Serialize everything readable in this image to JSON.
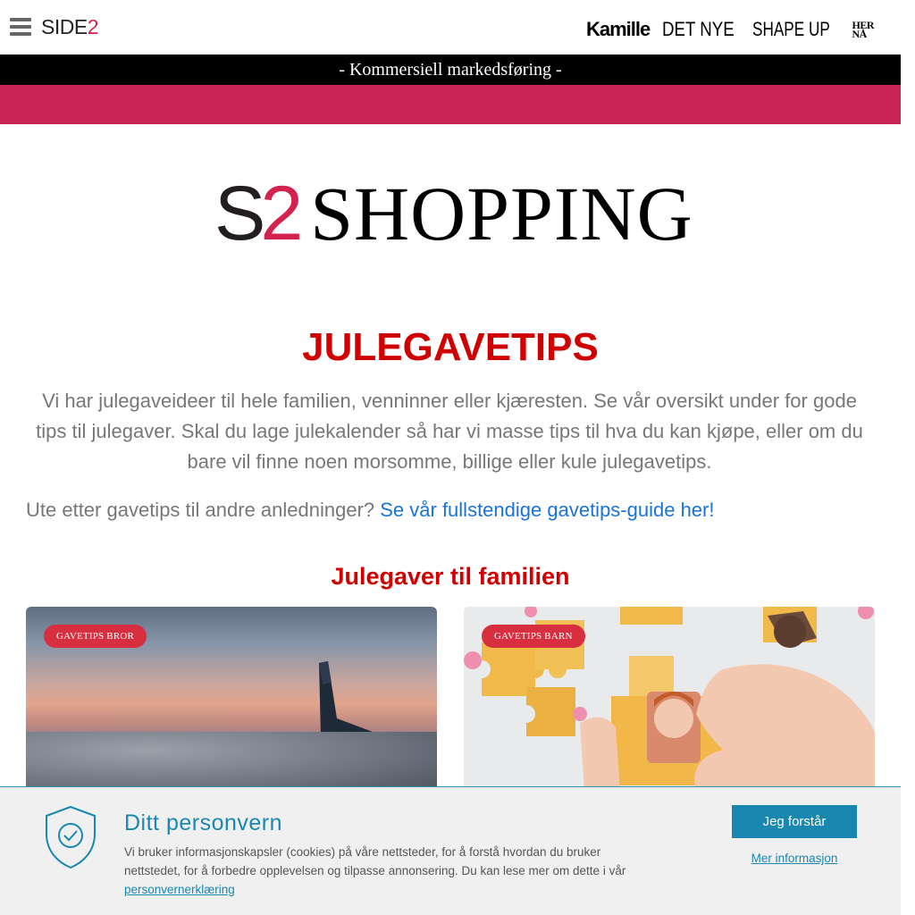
{
  "header": {
    "logo_text": "SIDE",
    "logo_number": "2",
    "partners": [
      "Kamille",
      "DET NYE",
      "SHAPE UP"
    ],
    "herna_line1": "HER",
    "herna_line2": "NÅ"
  },
  "commercial_label": "- Kommersiell markedsføring -",
  "brand": {
    "s": "S",
    "two": "2",
    "word": "SHOPPING",
    "accent_color": "#d4224e"
  },
  "main": {
    "heading": "JULEGAVETIPS",
    "intro": "Vi har julegaveideer til hele familien, venninner eller kjæresten. Se vår oversikt under for gode tips til julegaver. Skal du lage julekalender så har vi masse tips til hva du kan kjøpe, eller om du bare vil finne noen morsomme, billige eller kule julegavetips.",
    "more_text": "Ute etter gavetips til andre anledninger? ",
    "more_link": "Se vår fullstendige gavetips-guide her!",
    "subheading": "Julegaver til familien"
  },
  "cards": [
    {
      "badge": "GAVETIPS BROR"
    },
    {
      "badge": "GAVETIPS BARN"
    }
  ],
  "cookie": {
    "title": "Ditt personvern",
    "text": "Vi bruker informasjonskapsler (cookies) på våre nettsteder, for å forstå hvordan du bruker nettstedet, for å forbedre opplevelsen og tilpasse annonsering. Du kan lese mer om dette i vår ",
    "link": "personvernerklæring",
    "accept_label": "Jeg forstår",
    "more_info_label": "Mer informasjon"
  },
  "colors": {
    "commercial_bar": "#000000",
    "pink_bar": "#c92456",
    "heading": "#d00000",
    "link": "#1a73d9",
    "cookie_accent": "#1a87b0"
  }
}
